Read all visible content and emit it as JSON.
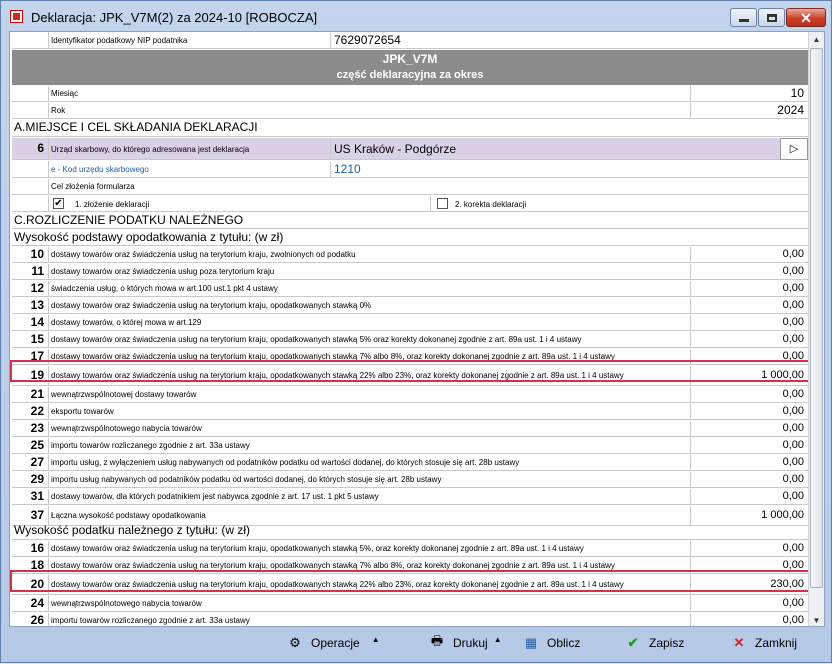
{
  "window": {
    "title": "Deklaracja: JPK_V7M(2) za 2024-10  [ROBOCZA]"
  },
  "nip": {
    "label": "Identyfikator podatkowy NIP podatnika",
    "value": "7629072654"
  },
  "header": {
    "line1": "JPK_V7M",
    "line2": "część deklaracyjna za okres"
  },
  "period": {
    "month_label": "Miesiąc",
    "month": "10",
    "year_label": "Rok",
    "year": "2024"
  },
  "sectionA": {
    "title": "A.MIEJSCE I CEL SKŁADANIA DEKLARACJI",
    "office_num": "6",
    "office_label": "Urząd skarbowy, do którego adresowana jest deklaracja",
    "office_value": "US Kraków - Podgórze",
    "office_btn": "▷",
    "code_label": "e - Kod urzędu skarbowego",
    "code_value": "1210",
    "purpose_label": "Cel złożenia formularza",
    "opt1": "1. złożenie deklaracji",
    "opt2": "2. korekta deklaracji"
  },
  "sectionC": {
    "title": "C.ROZLICZENIE PODATKU NALEŻNEGO",
    "sub1": "Wysokość podstawy opodatkowania z tytułu: (w zł)",
    "rows1": [
      {
        "num": "10",
        "label": "dostawy towarów oraz świadczenia usług na terytorium kraju, zwolnionych od podatku",
        "value": "0,00"
      },
      {
        "num": "11",
        "label": "dostawy towarów oraz świadczenia usług poza terytorium kraju",
        "value": "0,00"
      },
      {
        "num": "12",
        "label": "świadczenia usług, o których mowa w art.100 ust.1 pkt 4 ustawy",
        "value": "0,00"
      },
      {
        "num": "13",
        "label": "dostawy towarów oraz świadczenia usług na terytorium kraju, opodatkowanych stawką 0%",
        "value": "0,00"
      },
      {
        "num": "14",
        "label": "dostawy towarów, o której mowa w art.129",
        "value": "0,00"
      },
      {
        "num": "15",
        "label": "dostawy towarów oraz świadczenia usług na terytorium kraju, opodatkowanych stawką 5% oraz korekty dokonanej zgodnie z art. 89a ust. 1 i 4 ustawy",
        "value": "0,00"
      },
      {
        "num": "17",
        "label": "dostawy towarów oraz świadczenia usług na terytorium kraju, opodatkowanych stawką 7% albo 8%, oraz korekty dokonanej zgodnie z art. 89a ust. 1 i 4 ustawy",
        "value": "0,00"
      },
      {
        "num": "19",
        "label": "dostawy towarów oraz świadczenia usług na terytorium kraju, opodatkowanych stawką 22% albo 23%, oraz korekty dokonanej zgodnie z art. 89a ust. 1 i 4 ustawy",
        "value": "1 000,00"
      },
      {
        "num": "21",
        "label": "wewnątrzwspólnotowej dostawy towarów",
        "value": "0,00"
      },
      {
        "num": "22",
        "label": "eksportu towarów",
        "value": "0,00"
      },
      {
        "num": "23",
        "label": "wewnątrzwspólnotowego nabycia towarów",
        "value": "0,00"
      },
      {
        "num": "25",
        "label": "importu towarów rozliczanego zgodnie z art. 33a ustawy",
        "value": "0,00"
      },
      {
        "num": "27",
        "label": "importu usług, z wyłączeniem usług nabywanych od podatników podatku od wartości dodanej, do których stosuje się art. 28b ustawy",
        "value": "0,00"
      },
      {
        "num": "29",
        "label": "importu usług nabywanych od podatników podatku od wartości dodanej, do których stosuje się art. 28b ustawy",
        "value": "0,00"
      },
      {
        "num": "31",
        "label": "dostawy towarów, dla których podatnikiem jest nabywca zgodnie z art. 17 ust. 1 pkt 5 ustawy",
        "value": "0,00"
      },
      {
        "num": "37",
        "label": "Łączna wysokość podstawy opodatkowania",
        "value": "1 000,00"
      }
    ],
    "sub2": "Wysokość podatku należnego z tytułu: (w zł)",
    "rows2": [
      {
        "num": "16",
        "label": "dostawy towarów oraz świadczenia usług na terytorium kraju, opodatkowanych stawką 5%, oraz korekty dokonanej zgodnie z art. 89a ust. 1 i 4 ustawy",
        "value": "0,00"
      },
      {
        "num": "18",
        "label": "dostawy towarów oraz świadczenia usług na terytorium kraju, opodatkowanych stawką 7% albo 8%, oraz korekty dokonanej zgodnie z art. 89a ust. 1 i 4 ustawy",
        "value": "0,00"
      },
      {
        "num": "20",
        "label": "dostawy towarów oraz świadczenia usług na terytorium kraju, opodatkowanych stawką 22% albo 23%, oraz korekty dokonanej zgodnie z art. 89a ust. 1 i 4 ustawy",
        "value": "230,00"
      },
      {
        "num": "24",
        "label": "wewnątrzwspólnotowego nabycia towarów",
        "value": "0,00"
      },
      {
        "num": "26",
        "label": "importu towarów rozliczanego zgodnie z art. 33a ustawy",
        "value": "0,00"
      }
    ]
  },
  "footer": {
    "operacje": "Operacje",
    "drukuj": "Drukuj",
    "oblicz": "Oblicz",
    "zapisz": "Zapisz",
    "zamknij": "Zamknij"
  },
  "colors": {
    "highlight": "#d6304a",
    "header_band": "#8c8c8c",
    "purple_row": "#dcd0e6"
  }
}
